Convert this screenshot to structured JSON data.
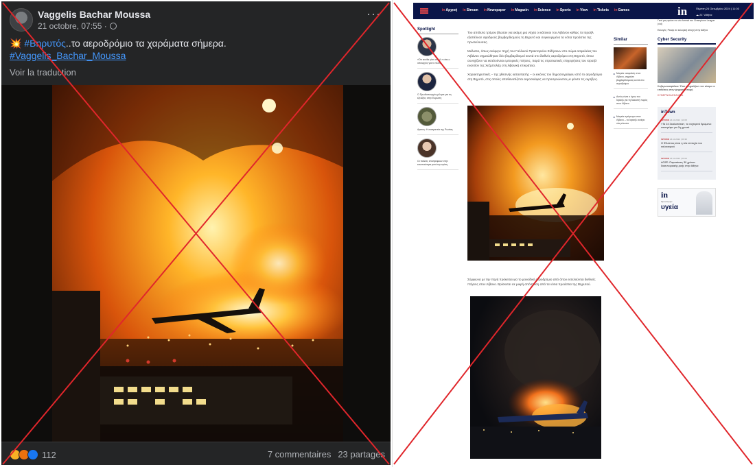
{
  "facebook_post": {
    "author": "Vaggelis Bachar Moussa",
    "timestamp": "21 octobre, 07:55 ·",
    "text_emoji": "💥",
    "hashtag_place": "#Βηρυτός",
    "text_body": "..το αεροδρόμιο τα χαράματα σήμερα.",
    "hashtag_author": "#Vaggelis_Bachar_Moussa",
    "translate_label": "Voir la traduction",
    "reaction_count": "112",
    "comments": "7 commentaires",
    "shares": "23 partages",
    "more_icon": "ellipsis-icon",
    "privacy_icon": "globe-icon",
    "reaction_icons": [
      "care-reaction-icon",
      "angry-reaction-icon",
      "like-reaction-icon"
    ],
    "reaction_colors": [
      "#f7b125",
      "#e9710f",
      "#1877f2"
    ]
  },
  "news_site": {
    "nav": [
      "Αρχική",
      "Stream",
      "Newspaper",
      "Magazin",
      "Science",
      "Sports",
      "View",
      "Tickets",
      "Games"
    ],
    "logo": "in",
    "date": "Πέμπτη 24 Οκτωβρίου 2024 | 11:03",
    "weather": "☁ 21° Αθήνα",
    "spotlight_title": "Spotlight",
    "spotlight_items": [
      "«Ότι και θα γίνει στο Δ.» είπε ο υπουργός για το τέλος",
      "Ο Πρωθυπουργός μίλησε για τις εξελίξεις στην Ευρώπη",
      "Αρκτος: Η εκστρατεία της Ρωσίας",
      "Οι πολίτες επιστρέφουν στην κανονικότητα μετά την κρίση"
    ],
    "article_para_1": "Του απόλυτα τρόμου βίωσαν για ακόμη μια νύχτα οι κάτοικοι του Λιβάνου καθώς το Ισραήλ εξαπέλυσε σφοδρούς βομβαρδισμούς τη Βηρυτό και συγκεκριμένα τα νότια προάστια της πρωτεύουσας.",
    "article_para_2": "Μάλιστα, όπως ανέφερε πηγή του Γαλλικού Πρακτορείου Ειδήσεων στο σώμα ασφαλείας του Λιβάνου σημειώθηκαν δύο βομβαρδισμοί κοντά στο διεθνές αεροδρόμιο στη Βηρυτό, όπου συνεχίζουν να εκτελούνται εμπορικές πτήσεις, παρά τις στρατιωτικές επιχειρήσεις του Ισραήλ εναντίον της Χεζμπολάχ στη λιβανική επικράτεια.",
    "article_para_3": "Χαρακτηριστικές – της χθεσινής καταστασής – οι εικόνες του δημοσιογράφου από το αεροδρόμιο στη Βηρυτό, στις οποίες αποθανατίζεται αεροσκάφος να προσγειώνεται με φόντο τις εκρήξεις.",
    "article_para_4": "Σύμφωνα με την πηγή πρόκειται για το μοναδικό αεροδρόμιο από όπου εκτελούνται διεθνείς πτήσεις στον Λίβανο. Βρίσκεται σε μικρή απόσταση από τα νότια προάστια της Βηρυτού.",
    "similar_title": "Similar",
    "similar_items": [
      "Μαγεία: ασφαλείς στον Λίβανο, σημαίνει βομβαρδισμούς κοντά στο αεροδρόμιο",
      "Αυτός είναι ο όρος του Ισραήλ για τη διακοπή πυρός στον Λίβανο",
      "Μαγεία πρόγευμα στον Λίβανο – το Ισραήλ ανοίγει νέο μέτωπο"
    ],
    "top_right_text": "Γιατί μας αρέσει το νέο format του Champions League (vid)",
    "top_right_sub": "Εκλογές: Ρεκόρ σε εκλογική αποχή στην Αθήνα",
    "cyber_title": "Cyber Security",
    "cyber_text": "Κυβερνοασφάλεια: Έτσι επηρεάζουν τον κόσμο οι επιθέσεις στην ψηφιακή εποχή",
    "cyber_badge": "ΚΥΒΕΡΝΟΑΣΦΑΛΕΙΑ",
    "intown_title": "inTown",
    "intown_items": [
      {
        "tag": "INTOWN",
        "date": "24.10.2024 | 10:05",
        "text": "«Τα 24 Σκαλοπάτια», το νυχτερινό δρώμενο επιστρέφει για 2η χρονιά"
      },
      {
        "tag": "INTOWN",
        "date": "24.10.2024 | 09:30",
        "text": "Ο Φίλιππος είναι η νέα επιτυχία του καλοκαιριού"
      },
      {
        "tag": "INTOWN",
        "date": "24.10.2024 | 09:00",
        "text": "ΑΟΖΕ: Παρατάσεις 30 χρόνια διασυνοριακής ροής στην Αθήνα"
      }
    ],
    "ad_logo": "in",
    "ad_sub": "Φροντίζουμε",
    "ad_title": "υγεία"
  },
  "colors": {
    "fb_bg": "#242526",
    "fb_text": "#e4e6eb",
    "fb_link": "#4599ff",
    "site_nav": "#0a1548",
    "site_accent": "#e5474b",
    "cross": "#e0262b"
  }
}
